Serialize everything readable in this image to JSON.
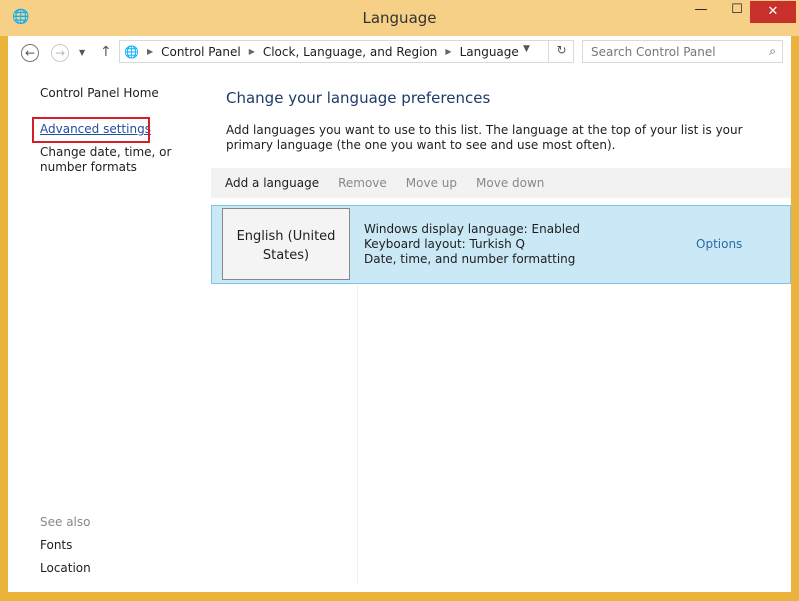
{
  "window": {
    "title": "Language",
    "minimize": "—",
    "maximize": "☐",
    "close": "✕"
  },
  "address": {
    "breadcrumbs": [
      "Control Panel",
      "Clock, Language, and Region",
      "Language"
    ],
    "search_placeholder": "Search Control Panel"
  },
  "sidebar": {
    "home": "Control Panel Home",
    "items": [
      "Advanced settings",
      "Change date, time, or number formats"
    ],
    "see_also": "See also",
    "see_also_items": [
      "Fonts",
      "Location"
    ]
  },
  "main": {
    "heading": "Change your language preferences",
    "description": "Add languages you want to use to this list. The language at the top of your list is your primary language (the one you want to see and use most often).",
    "toolbar": {
      "add": "Add a language",
      "remove": "Remove",
      "move_up": "Move up",
      "move_down": "Move down"
    },
    "languages": [
      {
        "name": "English (United States)",
        "details": [
          "Windows display language: Enabled",
          "Keyboard layout: Turkish Q",
          "Date, time, and number formatting"
        ],
        "options": "Options"
      }
    ]
  },
  "colors": {
    "frame": "#eab43c",
    "titlebar": "#f5d086",
    "selection": "#cbe8f6",
    "highlight_box": "#d21f2a",
    "link": "#1f4fa0"
  }
}
